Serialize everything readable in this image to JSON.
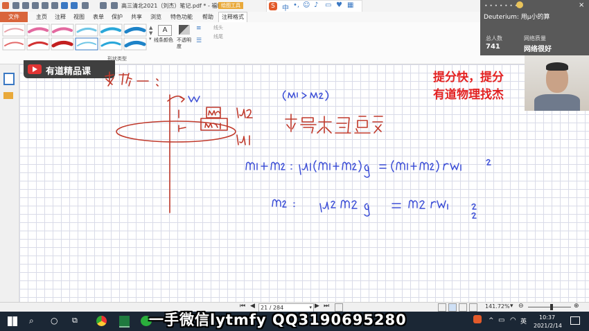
{
  "titlebar": {
    "doc_title": "高三清北2021（刘杰）笔记.pdf * - 福昕阅读器",
    "drawing_tools_tab": "绘图工具"
  },
  "ribbon": {
    "tabs": [
      "文件",
      "主页",
      "注释",
      "视图",
      "表单",
      "保护",
      "共享",
      "浏览",
      "特色功能",
      "帮助"
    ],
    "active_tab": "注释格式",
    "line_color_label": "线条颜色",
    "opacity_label": "不透明度",
    "line_start_label": "线头",
    "line_end_label": "线尾",
    "shape_type_label": "形状类型"
  },
  "document": {
    "logo_text": "有道精品课",
    "promo_line1": "提分快，提分",
    "promo_line2": "有道物理找杰"
  },
  "live_panel": {
    "username": "Deuterium: 用μ小的算",
    "viewers_label": "总人数",
    "viewers_count": "741",
    "network_label": "网络质量",
    "network_status": "网络很好"
  },
  "navbar": {
    "page_indicator": "21 / 284",
    "zoom": "141.72%"
  },
  "taskbar": {
    "ime": "英",
    "time": "10:37",
    "date": "2021/2/14"
  },
  "watermark": "一手微信lytmfy  QQ3190695280",
  "colors": {
    "accent": "#d9653b",
    "promo": "#e32222",
    "ink": "#c0392b",
    "pen": "#3d4fd6"
  }
}
